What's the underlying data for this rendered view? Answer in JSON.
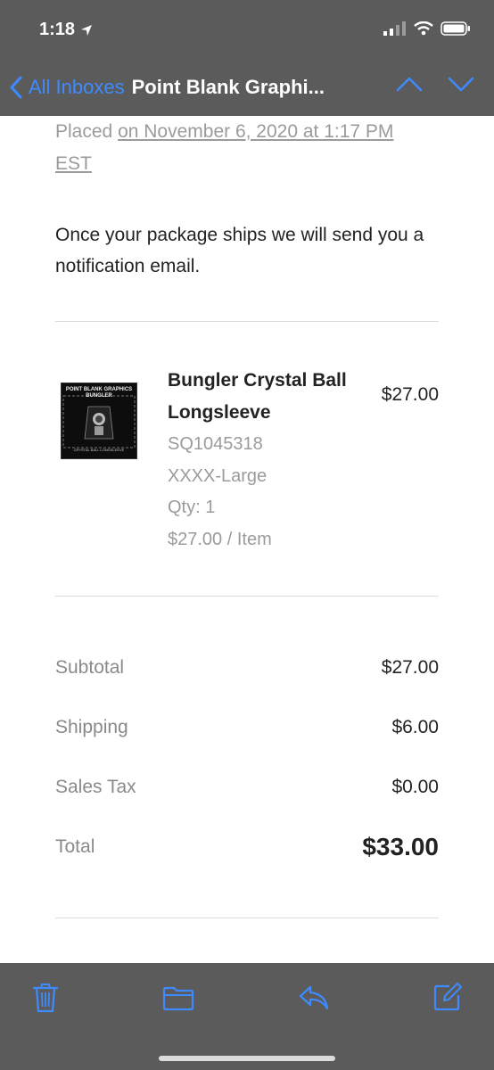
{
  "status_bar": {
    "time": "1:18"
  },
  "nav": {
    "back_label": "All Inboxes",
    "title": "Point Blank Graphi..."
  },
  "email": {
    "placed_line1_prefix": "Placed",
    "placed_line1_link": "on November 6, 2020 at 1:17 PM",
    "placed_line2": "EST",
    "notice": "Once your package ships we will send you a notification email.",
    "item": {
      "thumb_text_top": "POINT BLANK GRAPHICS",
      "thumb_text_mid": "BUNGLER",
      "thumb_text_bottom": "CRYSTAL BALL LONGSLEEVE",
      "name_line1": "Bungler Crystal Ball",
      "name_line2": "Longsleeve",
      "sku": "SQ1045318",
      "size": "XXXX-Large",
      "qty": "Qty: 1",
      "unit_price": "$27.00 / Item",
      "price": "$27.00"
    },
    "totals": [
      {
        "label": "Subtotal",
        "value": "$27.00"
      },
      {
        "label": "Shipping",
        "value": "$6.00"
      },
      {
        "label": "Sales Tax",
        "value": "$0.00"
      },
      {
        "label": "Total",
        "value": "$33.00"
      }
    ]
  },
  "colors": {
    "accent": "#3d8bff",
    "bar": "#5b5b5b"
  },
  "toolbar_icons": [
    "trash-icon",
    "folder-icon",
    "reply-icon",
    "compose-icon"
  ]
}
